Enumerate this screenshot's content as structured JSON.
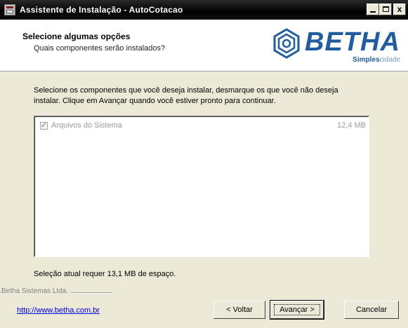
{
  "window": {
    "title": "Assistente de Instalação - AutoCotacao",
    "controls": {
      "minimize": "",
      "maximize": "",
      "close": "x"
    }
  },
  "header": {
    "title": "Selecione algumas opções",
    "subtitle": "Quais componentes serão instalados?",
    "logo": {
      "brand": "BETHA",
      "tag_bold": "Simples",
      "tag_light": "cidade"
    }
  },
  "main": {
    "description": "Selecione os componentes que você deseja instalar, desmarque os que você não deseja instalar. Clique em Avançar quando você estiver pronto para continuar.",
    "components": [
      {
        "label": "Arquivos do Sistema",
        "size": "12,4 MB",
        "checked": true,
        "disabled": true
      }
    ],
    "space_required": "Seleção atual requer 13,1 MB de espaço."
  },
  "footer": {
    "brand_text": "Betha Sistemas Ltda.",
    "link": "http://www.betha.com.br",
    "back_label": "< Voltar",
    "next_label": "Avançar >",
    "cancel_label": "Cancelar"
  },
  "colors": {
    "brand_blue": "#1f5da0",
    "titlebar": "#000000",
    "dialog_bg": "#ece9d8"
  }
}
